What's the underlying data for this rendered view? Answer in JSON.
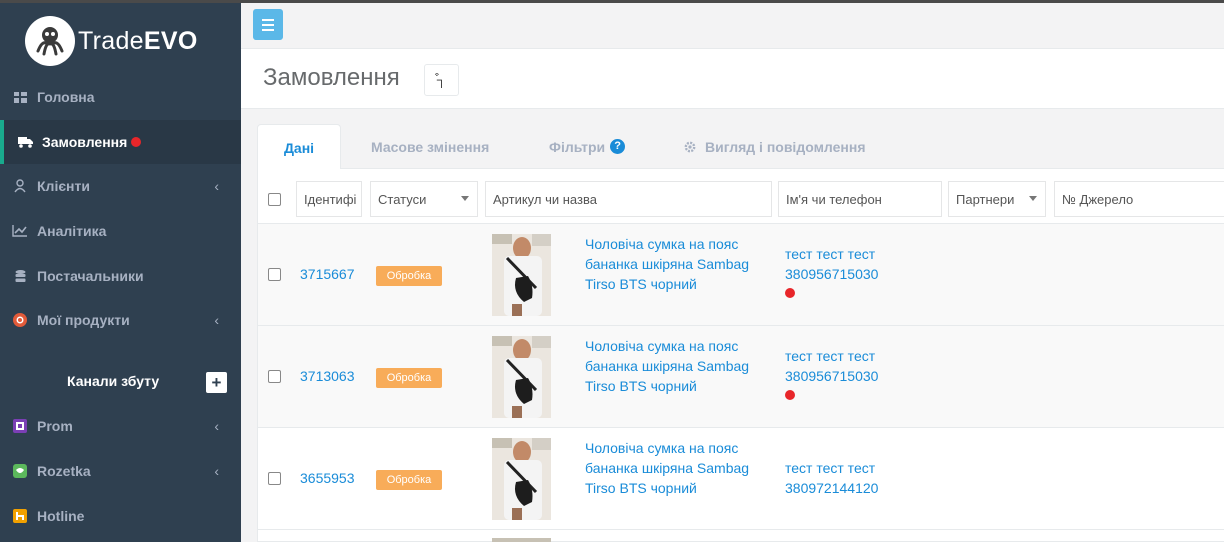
{
  "app": {
    "logo_text_light": "Trade",
    "logo_text_bold": "EVO"
  },
  "sidebar": {
    "items": [
      {
        "label": "Головна",
        "icon": "grid-icon"
      },
      {
        "label": "Замовлення",
        "icon": "truck-icon",
        "active": true,
        "has_dot": true
      },
      {
        "label": "Клієнти",
        "icon": "user-icon",
        "chevron": "‹"
      },
      {
        "label": "Аналітика",
        "icon": "chart-icon"
      },
      {
        "label": "Постачальники",
        "icon": "database-icon"
      },
      {
        "label": "Мої продукти",
        "icon": "product-icon",
        "chevron": "‹"
      },
      {
        "label": "Prom",
        "icon": "prom-icon",
        "chevron": "‹"
      },
      {
        "label": "Rozetka",
        "icon": "rozetka-icon",
        "chevron": "‹"
      },
      {
        "label": "Hotline",
        "icon": "hotline-icon"
      }
    ],
    "channels_title": "Канали збуту",
    "add_label": "+"
  },
  "page": {
    "title": "Замовлення",
    "title_button": "͒┐"
  },
  "tabs": [
    {
      "label": "Дані",
      "active": true
    },
    {
      "label": "Масове змінення"
    },
    {
      "label": "Фільтри",
      "help": "?"
    },
    {
      "label": "Вигляд і повідомлення",
      "icon": "gear-icon"
    }
  ],
  "filters": {
    "id_placeholder": "Ідентифі",
    "status_label": "Статуси",
    "article_placeholder": "Артикул чи назва",
    "customer_placeholder": "Ім'я чи телефон",
    "partners_label": "Партнери",
    "source_placeholder": "№ Джерело"
  },
  "orders": [
    {
      "id": "3715667",
      "status": "Обробка",
      "product": "Чоловіча сумка на пояс бананка шкіряна Sambag Tirso BTS чорний",
      "customer_name": "тест тест тест",
      "customer_phone": "380956715030",
      "flag": true
    },
    {
      "id": "3713063",
      "status": "Обробка",
      "product": "Чоловіча сумка на пояс бананка шкіряна Sambag Tirso BTS чорний",
      "customer_name": "тест тест тест",
      "customer_phone": "380956715030",
      "flag": true
    },
    {
      "id": "3655953",
      "status": "Обробка",
      "product": "Чоловіча сумка на пояс бананка шкіряна Sambag Tirso BTS чорний",
      "customer_name": "тест тест тест",
      "customer_phone": "380972144120",
      "flag": false
    }
  ],
  "colors": {
    "sidebar_bg": "#2f4050",
    "accent": "#1a8cd8",
    "badge": "#f8ac59",
    "dot": "#e8262a",
    "menu_btn": "#5bb8e8"
  }
}
